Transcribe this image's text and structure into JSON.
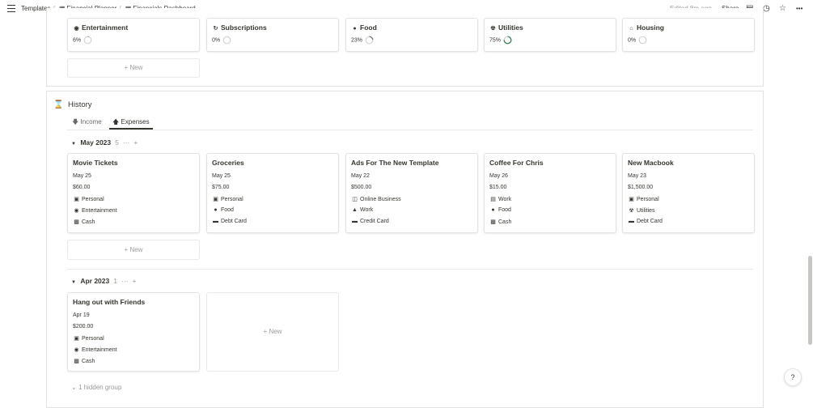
{
  "breadcrumb": {
    "items": [
      {
        "icon": "",
        "label": "Templates"
      },
      {
        "icon": "planner-icon",
        "label": "Financial Planner"
      },
      {
        "icon": "planner-icon",
        "label": "Financials Dashboard"
      }
    ],
    "separator": "/"
  },
  "topbar": {
    "edited": "Edited 8m ago",
    "share": "Share",
    "more": "•••"
  },
  "budget_cards": [
    {
      "title": "Entertainment",
      "icon": "entertainment-icon",
      "percent": "6%",
      "progress": 0.06
    },
    {
      "title": "Subscriptions",
      "icon": "subscriptions-icon",
      "percent": "0%",
      "progress": 0.0
    },
    {
      "title": "Food",
      "icon": "food-icon",
      "percent": "23%",
      "progress": 0.23
    },
    {
      "title": "Utilities",
      "icon": "utilities-icon",
      "percent": "75%",
      "progress": 0.75
    },
    {
      "title": "Housing",
      "icon": "housing-icon",
      "percent": "0%",
      "progress": 0.0
    }
  ],
  "new_label": "+ New",
  "history": {
    "title": "History",
    "tabs": [
      {
        "label": "Income",
        "icon": "arrow-down-icon",
        "active": false
      },
      {
        "label": "Expenses",
        "icon": "arrow-up-icon",
        "active": true
      }
    ],
    "groups": [
      {
        "label": "May 2023",
        "count": "5",
        "more": "···",
        "add": "+",
        "cards": [
          {
            "title": "Movie Tickets",
            "date": "May 25",
            "amount": "$60.00",
            "category": "Personal",
            "type": "Entertainment",
            "payment": "Cash"
          },
          {
            "title": "Groceries",
            "date": "May 25",
            "amount": "$75.00",
            "category": "Personal",
            "type": "Food",
            "payment": "Debt Card"
          },
          {
            "title": "Ads For The New Template",
            "date": "May 22",
            "amount": "$500.00",
            "category": "Online Business",
            "type": "Work",
            "payment": "Credit Card"
          },
          {
            "title": "Coffee For Chris",
            "date": "May 26",
            "amount": "$15.00",
            "category": "Work",
            "type": "Food",
            "payment": "Cash"
          },
          {
            "title": "New Macbook",
            "date": "May 23",
            "amount": "$1,500.00",
            "category": "Personal",
            "type": "Utilities",
            "payment": "Debt Card"
          }
        ]
      },
      {
        "label": "Apr 2023",
        "count": "1",
        "more": "···",
        "add": "+",
        "cards": [
          {
            "title": "Hang out with Friends",
            "date": "Apr 19",
            "amount": "$200.00",
            "category": "Personal",
            "type": "Entertainment",
            "payment": "Cash"
          }
        ]
      }
    ],
    "hidden_groups": "1 hidden group"
  },
  "help": "?",
  "colors": {
    "progress_green": "#448361",
    "ring_track": "#d3d2cf"
  }
}
